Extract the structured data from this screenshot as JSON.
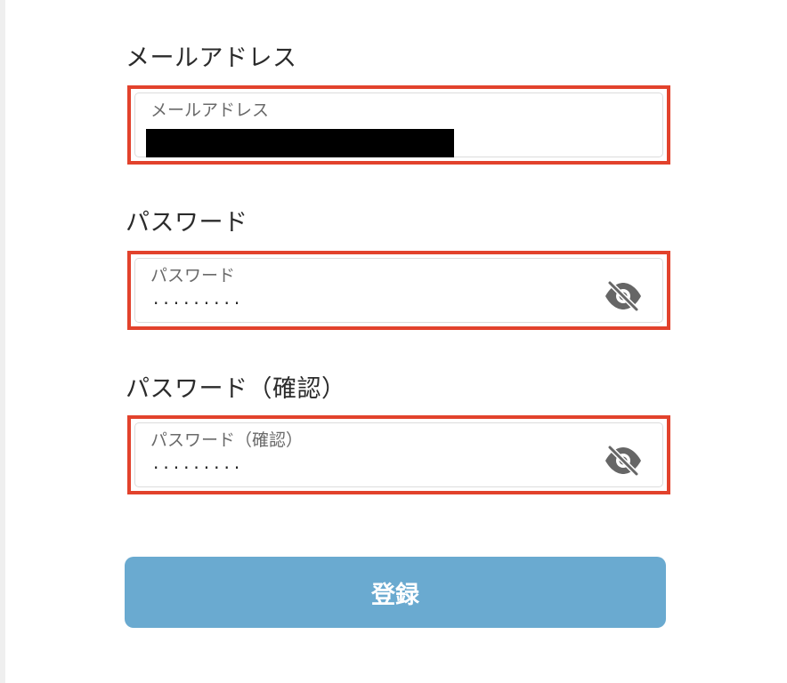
{
  "form": {
    "email": {
      "title": "メールアドレス",
      "label": "メールアドレス",
      "value_redacted": true
    },
    "password": {
      "title": "パスワード",
      "label": "パスワード",
      "masked_value": "·········",
      "visibility_icon": "eye-slash-icon"
    },
    "password_confirm": {
      "title": "パスワード（確認）",
      "label": "パスワード（確認）",
      "masked_value": "·········",
      "visibility_icon": "eye-slash-icon"
    },
    "submit_label": "登録"
  },
  "colors": {
    "highlight_border": "#e2422c",
    "submit_background": "#6aaad0",
    "submit_text": "#ffffff",
    "icon": "#666666"
  }
}
